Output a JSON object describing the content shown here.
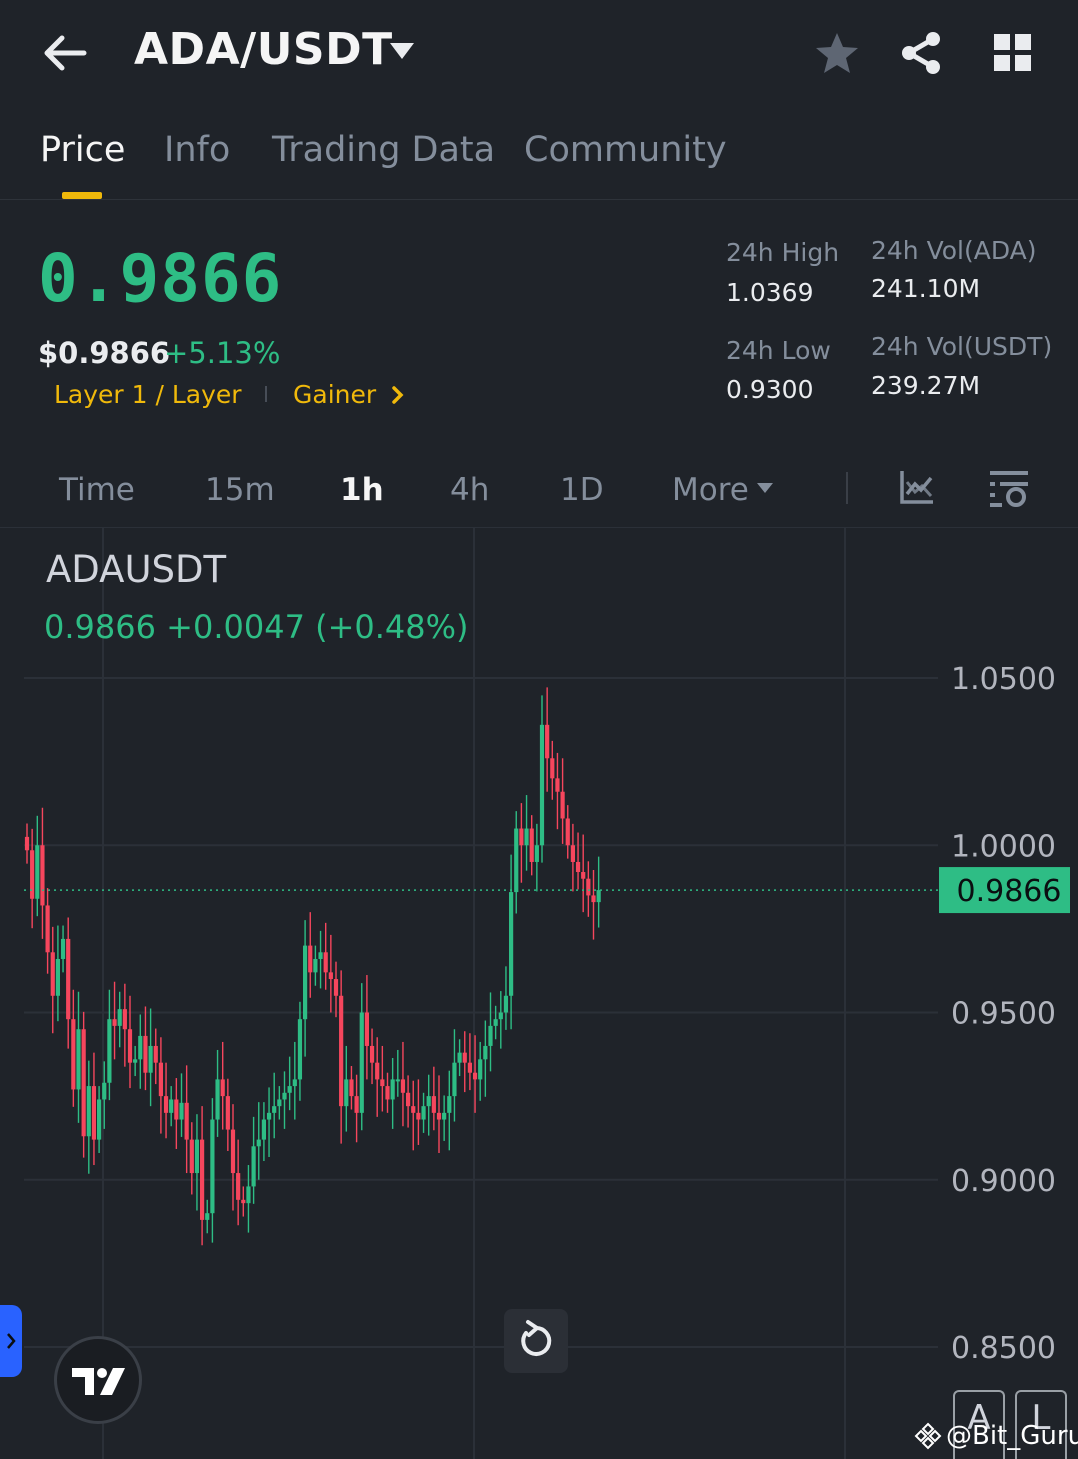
{
  "header": {
    "pair": "ADA/USDT"
  },
  "tabs": [
    {
      "label": "Price",
      "active": true
    },
    {
      "label": "Info",
      "active": false
    },
    {
      "label": "Trading Data",
      "active": false
    },
    {
      "label": "Community",
      "active": false
    }
  ],
  "ticker": {
    "last_price": "0.9866",
    "usd_price": "$0.9866",
    "change_pct": "+5.13%",
    "tag_sector": "Layer 1 / Layer",
    "tag_gainer": "Gainer",
    "high_label": "24h High",
    "high_value": "1.0369",
    "low_label": "24h Low",
    "low_value": "0.9300",
    "vol_base_label": "24h Vol(ADA)",
    "vol_base_value": "241.10M",
    "vol_quote_label": "24h Vol(USDT)",
    "vol_quote_value": "239.27M"
  },
  "intervals": {
    "time": "Time",
    "m15": "15m",
    "h1": "1h",
    "h4": "4h",
    "d1": "1D",
    "more": "More",
    "active": "1h"
  },
  "chart_header": {
    "symbol": "ADAUSDT",
    "ohlc": "0.9866  +0.0047 (+0.48%)"
  },
  "mode_buttons": {
    "auto": "A",
    "log": "L"
  },
  "watermark": "@Bit_Guru",
  "colors": {
    "up": "#2ebd85",
    "down": "#f6465d",
    "accent": "#f0b90b",
    "background": "#1f2329"
  },
  "chart_data": {
    "type": "candlestick",
    "title": "ADAUSDT",
    "y_ticks": [
      "1.0500",
      "1.0000",
      "0.9500",
      "0.9000",
      "0.8500"
    ],
    "y_tick_values": [
      1.05,
      1.0,
      0.95,
      0.9,
      0.85
    ],
    "ylim": [
      0.82,
      1.07
    ],
    "last_price_label": "0.9866",
    "last_price": 0.9866,
    "grid": true,
    "closes": [
      0.9985,
      0.984,
      1.0,
      0.982,
      0.968,
      0.955,
      0.966,
      0.972,
      0.948,
      0.927,
      0.945,
      0.913,
      0.928,
      0.912,
      0.924,
      0.929,
      0.948,
      0.946,
      0.951,
      0.945,
      0.935,
      0.936,
      0.943,
      0.932,
      0.94,
      0.935,
      0.925,
      0.92,
      0.924,
      0.918,
      0.923,
      0.912,
      0.902,
      0.912,
      0.888,
      0.89,
      0.918,
      0.93,
      0.925,
      0.915,
      0.902,
      0.894,
      0.893,
      0.898,
      0.91,
      0.912,
      0.918,
      0.92,
      0.922,
      0.924,
      0.926,
      0.928,
      0.93,
      0.948,
      0.97,
      0.962,
      0.966,
      0.968,
      0.962,
      0.96,
      0.955,
      0.922,
      0.93,
      0.925,
      0.92,
      0.95,
      0.94,
      0.935,
      0.93,
      0.928,
      0.924,
      0.93,
      0.93,
      0.926,
      0.922,
      0.92,
      0.918,
      0.922,
      0.925,
      0.92,
      0.918,
      0.92,
      0.925,
      0.935,
      0.938,
      0.935,
      0.932,
      0.93,
      0.936,
      0.94,
      0.946,
      0.948,
      0.95,
      0.955,
      0.986,
      1.005,
      1.0,
      1.005,
      0.995,
      1.0,
      1.036,
      1.026,
      1.02,
      1.016,
      1.008,
      1.0,
      0.995,
      0.992,
      0.99,
      0.985,
      0.983,
      0.9866
    ]
  }
}
